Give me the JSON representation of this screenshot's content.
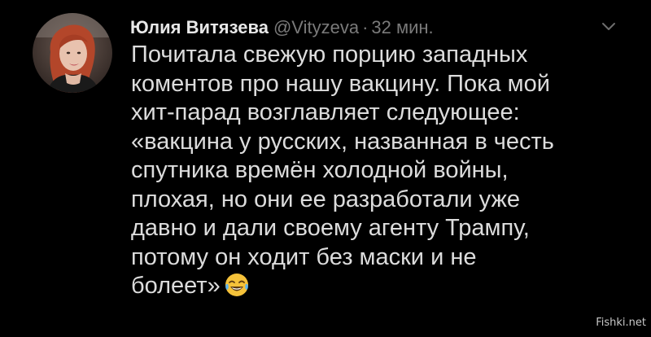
{
  "tweet": {
    "author": {
      "name": "Юлия Витязева",
      "handle": "@Vityzeva",
      "separator": "·",
      "timestamp": "32 мин."
    },
    "body_lines": [
      "Почитала свежую порцию западных",
      "коментов про нашу вакцину. Пока мой",
      "хит-парад возглавляет следующее:",
      "«вакцина у русских, названная в честь",
      "спутника времён холодной войны,",
      "плохая, но они ее разработали уже",
      "давно и дали своему агенту Трампу,",
      "потому он ходит без маски и не",
      "болеет»"
    ],
    "emoji": "face-with-tears-of-joy",
    "menu_icon": "chevron-down-icon"
  },
  "watermark": "Fishki.net",
  "colors": {
    "background": "#000000",
    "text": "#dcdcdc",
    "muted": "#7a7a7a",
    "emoji_face": "#f5c23a"
  }
}
